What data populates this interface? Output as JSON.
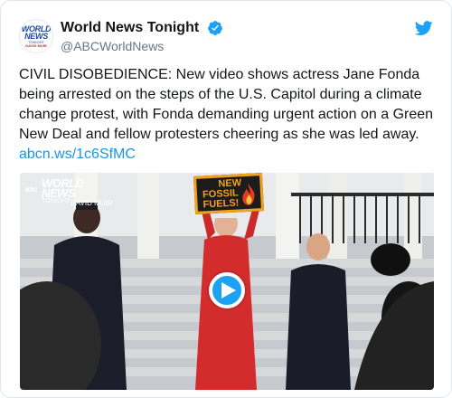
{
  "account": {
    "display_name": "World News Tonight",
    "handle": "@ABCWorldNews",
    "avatar_text": [
      "WORLD",
      "NEWS",
      "TONIGHT",
      "DAVID MUIR"
    ],
    "verified": true
  },
  "tweet": {
    "text": "CIVIL DISOBEDIENCE: New video shows actress Jane Fonda being arrested on the steps of the U.S. Capitol during a climate change protest, with Fonda demanding urgent action on a Green New Deal and fellow protesters cheering as she was led away. ",
    "link": "abcn.ws/1c6SfMC"
  },
  "media": {
    "type": "video",
    "watermark": {
      "network": "abc",
      "line1": "WORLD",
      "line2": "NEWS",
      "line3": "TONIGHT",
      "anchor": "DAVID MUIR"
    },
    "sign_text": [
      "NEW",
      "FOSSIL",
      "FUELS!"
    ]
  },
  "icons": {
    "verified": "verified-badge-icon",
    "brand": "twitter-bird-icon",
    "play": "play-icon"
  },
  "colors": {
    "link": "#1b95e0",
    "brand": "#1da1f2",
    "handle": "#657786",
    "sign": "#f2a21a"
  }
}
